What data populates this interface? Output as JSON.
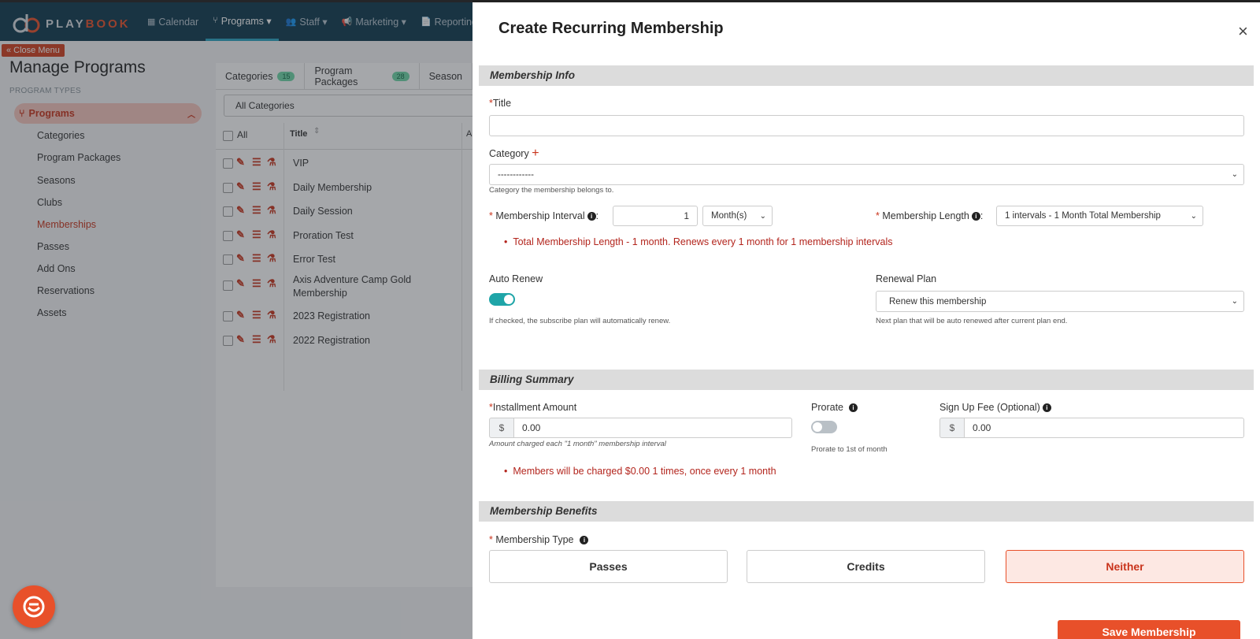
{
  "app": {
    "logo_play": "PLAY",
    "logo_book": "BOOK",
    "nav": [
      {
        "icon": "▦",
        "label": "Calendar"
      },
      {
        "icon": "⑂",
        "label": "Programs ▾"
      },
      {
        "icon": "👥",
        "label": "Staff ▾"
      },
      {
        "icon": "📢",
        "label": "Marketing ▾"
      },
      {
        "icon": "📄",
        "label": "Reporting"
      }
    ],
    "close_menu": "« Close Menu",
    "page_title": "Manage Programs",
    "program_types_label": "PROGRAM TYPES",
    "programs_label": "Programs",
    "sidebar_items": [
      "Categories",
      "Program Packages",
      "Seasons",
      "Clubs",
      "Memberships",
      "Passes",
      "Add Ons",
      "Reservations",
      "Assets"
    ],
    "tabs": [
      {
        "label": "Categories",
        "count": "15"
      },
      {
        "label": "Program Packages",
        "count": "28"
      },
      {
        "label": "Season",
        "count": ""
      }
    ],
    "category_filter": "All Categories",
    "col_all": "All",
    "col_title": "Title",
    "col_a": "A",
    "rows": [
      "VIP",
      "Daily Membership",
      "Daily Session",
      "Proration Test",
      "Error Test",
      "Axis Adventure Camp Gold",
      "2023 Registration",
      "2022 Registration"
    ],
    "row_subtitle": "Membership"
  },
  "modal": {
    "title": "Create Recurring Membership",
    "close": "×",
    "sections": {
      "info": "Membership Info",
      "billing": "Billing Summary",
      "benefits": "Membership Benefits"
    },
    "title_label": "Title",
    "title_value": "",
    "category_label": "Category",
    "category_add": "+",
    "category_value": "------------",
    "category_help": "Category the membership belongs to.",
    "interval_label": "Membership Interval",
    "interval_value": "1",
    "interval_unit": "Month(s)",
    "length_label": "Membership Length",
    "length_value": "1 intervals - 1 Month Total Membership",
    "length_note": "Total Membership Length - 1 month. Renews every 1 month for 1 membership intervals",
    "auto_renew_label": "Auto Renew",
    "auto_renew_on": true,
    "auto_renew_help": "If checked, the subscribe plan will automatically renew.",
    "renewal_label": "Renewal Plan",
    "renewal_value": "Renew this membership",
    "renewal_help": "Next plan that will be auto renewed after current plan end.",
    "installment_label": "Installment Amount",
    "currency": "$",
    "installment_value": "0.00",
    "installment_help": "Amount charged each \"1 month\" membership interval",
    "prorate_label": "Prorate",
    "prorate_on": false,
    "prorate_help": "Prorate to 1st of month",
    "signup_label": "Sign Up Fee (Optional)",
    "signup_value": "0.00",
    "charge_note": "Members will be charged $0.00 1 times, once every 1 month",
    "type_label": "Membership Type",
    "types": [
      "Passes",
      "Credits",
      "Neither"
    ],
    "selected_type": "Neither",
    "save_label": "Save Membership"
  },
  "colors": {
    "brand": "#e8502a",
    "toggle_on": "#1fa5a8",
    "nav_bg": "#0e3a4f"
  }
}
